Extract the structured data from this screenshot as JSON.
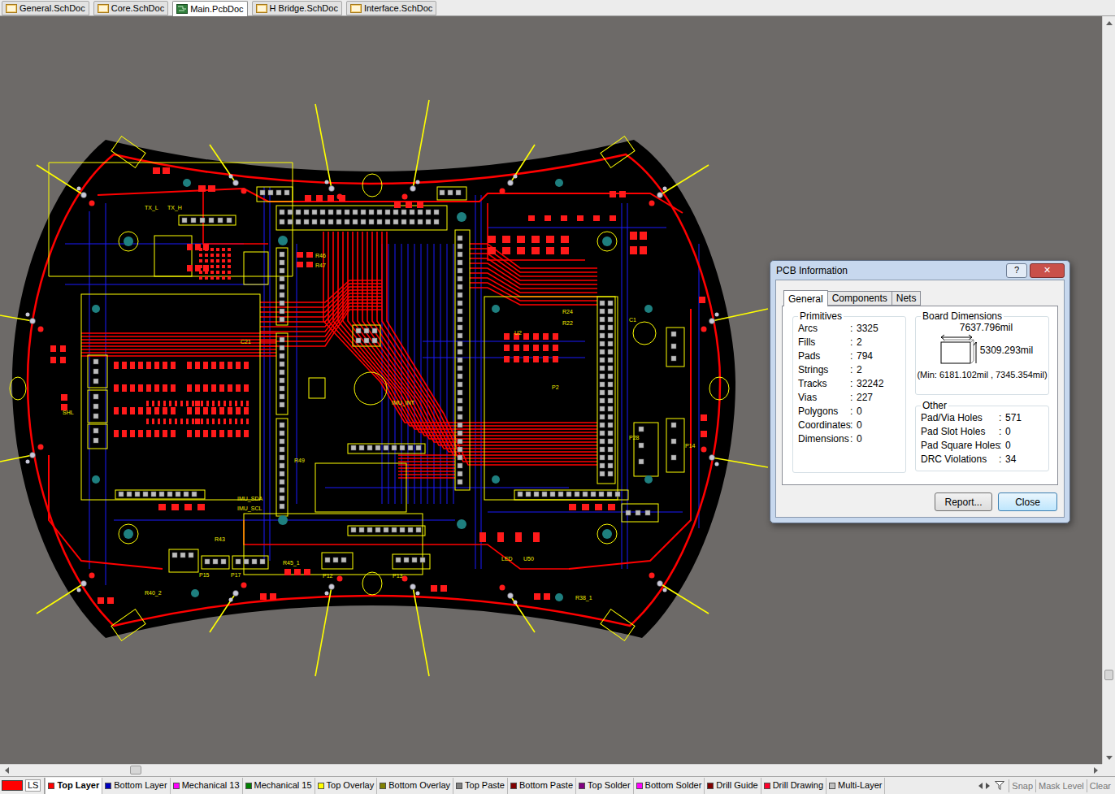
{
  "document_tabs": [
    {
      "label": "General.SchDoc",
      "selected": false,
      "kind": "sch"
    },
    {
      "label": "Core.SchDoc",
      "selected": false,
      "kind": "sch"
    },
    {
      "label": "Main.PcbDoc",
      "selected": true,
      "kind": "pcb"
    },
    {
      "label": "H Bridge.SchDoc",
      "selected": false,
      "kind": "sch"
    },
    {
      "label": "Interface.SchDoc",
      "selected": false,
      "kind": "sch"
    }
  ],
  "board": {
    "labels": [
      "TX_L",
      "TX_H",
      "R46",
      "R47",
      "R49",
      "C21",
      "R24",
      "R22",
      "IMU_INT",
      "IMU_SDA",
      "IMU_SCL",
      "SHL",
      "LED",
      "U50",
      "P15",
      "P17",
      "P13",
      "P12",
      "R40_2",
      "R38_1",
      "P28",
      "P14",
      "C1",
      "U2",
      "R43",
      "R45_1",
      "P2"
    ]
  },
  "scroll": {
    "vertical": 0.9,
    "horizontal": 0.11
  },
  "dialog": {
    "title": "PCB Information",
    "help": "?",
    "close": "✕",
    "tabs": [
      {
        "label": "General",
        "selected": true
      },
      {
        "label": "Components",
        "selected": false
      },
      {
        "label": "Nets",
        "selected": false
      }
    ],
    "separator": ":",
    "primitives": {
      "title": "Primitives",
      "rows": [
        {
          "label": "Arcs",
          "value": "3325"
        },
        {
          "label": "Fills",
          "value": "2"
        },
        {
          "label": "Pads",
          "value": "794"
        },
        {
          "label": "Strings",
          "value": "2"
        },
        {
          "label": "Tracks",
          "value": "32242"
        },
        {
          "label": "Vias",
          "value": "227"
        },
        {
          "label": "Polygons",
          "value": "0"
        },
        {
          "label": "Coordinates",
          "value": "0"
        },
        {
          "label": "Dimensions",
          "value": "0"
        }
      ]
    },
    "dimensions": {
      "title": "Board Dimensions",
      "width": "7637.796mil",
      "height": "5309.293mil",
      "min": "(Min: 6181.102mil , 7345.354mil)"
    },
    "other": {
      "title": "Other",
      "rows": [
        {
          "label": "Pad/Via Holes",
          "value": "571"
        },
        {
          "label": "Pad Slot Holes",
          "value": "0"
        },
        {
          "label": "Pad Square Holes",
          "value": "0"
        },
        {
          "label": "DRC Violations",
          "value": "34"
        }
      ]
    },
    "buttons": [
      {
        "label": "Report...",
        "selected": false
      },
      {
        "label": "Close",
        "selected": true
      }
    ]
  },
  "layer_bar": {
    "current": "LS",
    "current_color": "#ff0000",
    "layers": [
      {
        "label": "Top Layer",
        "selected": true,
        "color": "#ff0000"
      },
      {
        "label": "Bottom Layer",
        "selected": false,
        "color": "#0000c0"
      },
      {
        "label": "Mechanical 13",
        "selected": false,
        "color": "#ff00ff"
      },
      {
        "label": "Mechanical 15",
        "selected": false,
        "color": "#008000"
      },
      {
        "label": "Top Overlay",
        "selected": false,
        "color": "#ffff00"
      },
      {
        "label": "Bottom Overlay",
        "selected": false,
        "color": "#808000"
      },
      {
        "label": "Top Paste",
        "selected": false,
        "color": "#808080"
      },
      {
        "label": "Bottom Paste",
        "selected": false,
        "color": "#800000"
      },
      {
        "label": "Top Solder",
        "selected": false,
        "color": "#800080"
      },
      {
        "label": "Bottom Solder",
        "selected": false,
        "color": "#ff00ff"
      },
      {
        "label": "Drill Guide",
        "selected": false,
        "color": "#800000"
      },
      {
        "label": "Drill Drawing",
        "selected": false,
        "color": "#ff002a"
      },
      {
        "label": "Multi-Layer",
        "selected": false,
        "color": "#c0c0c0"
      }
    ],
    "tools": [
      "Snap",
      "Mask Level",
      "Clear"
    ]
  }
}
